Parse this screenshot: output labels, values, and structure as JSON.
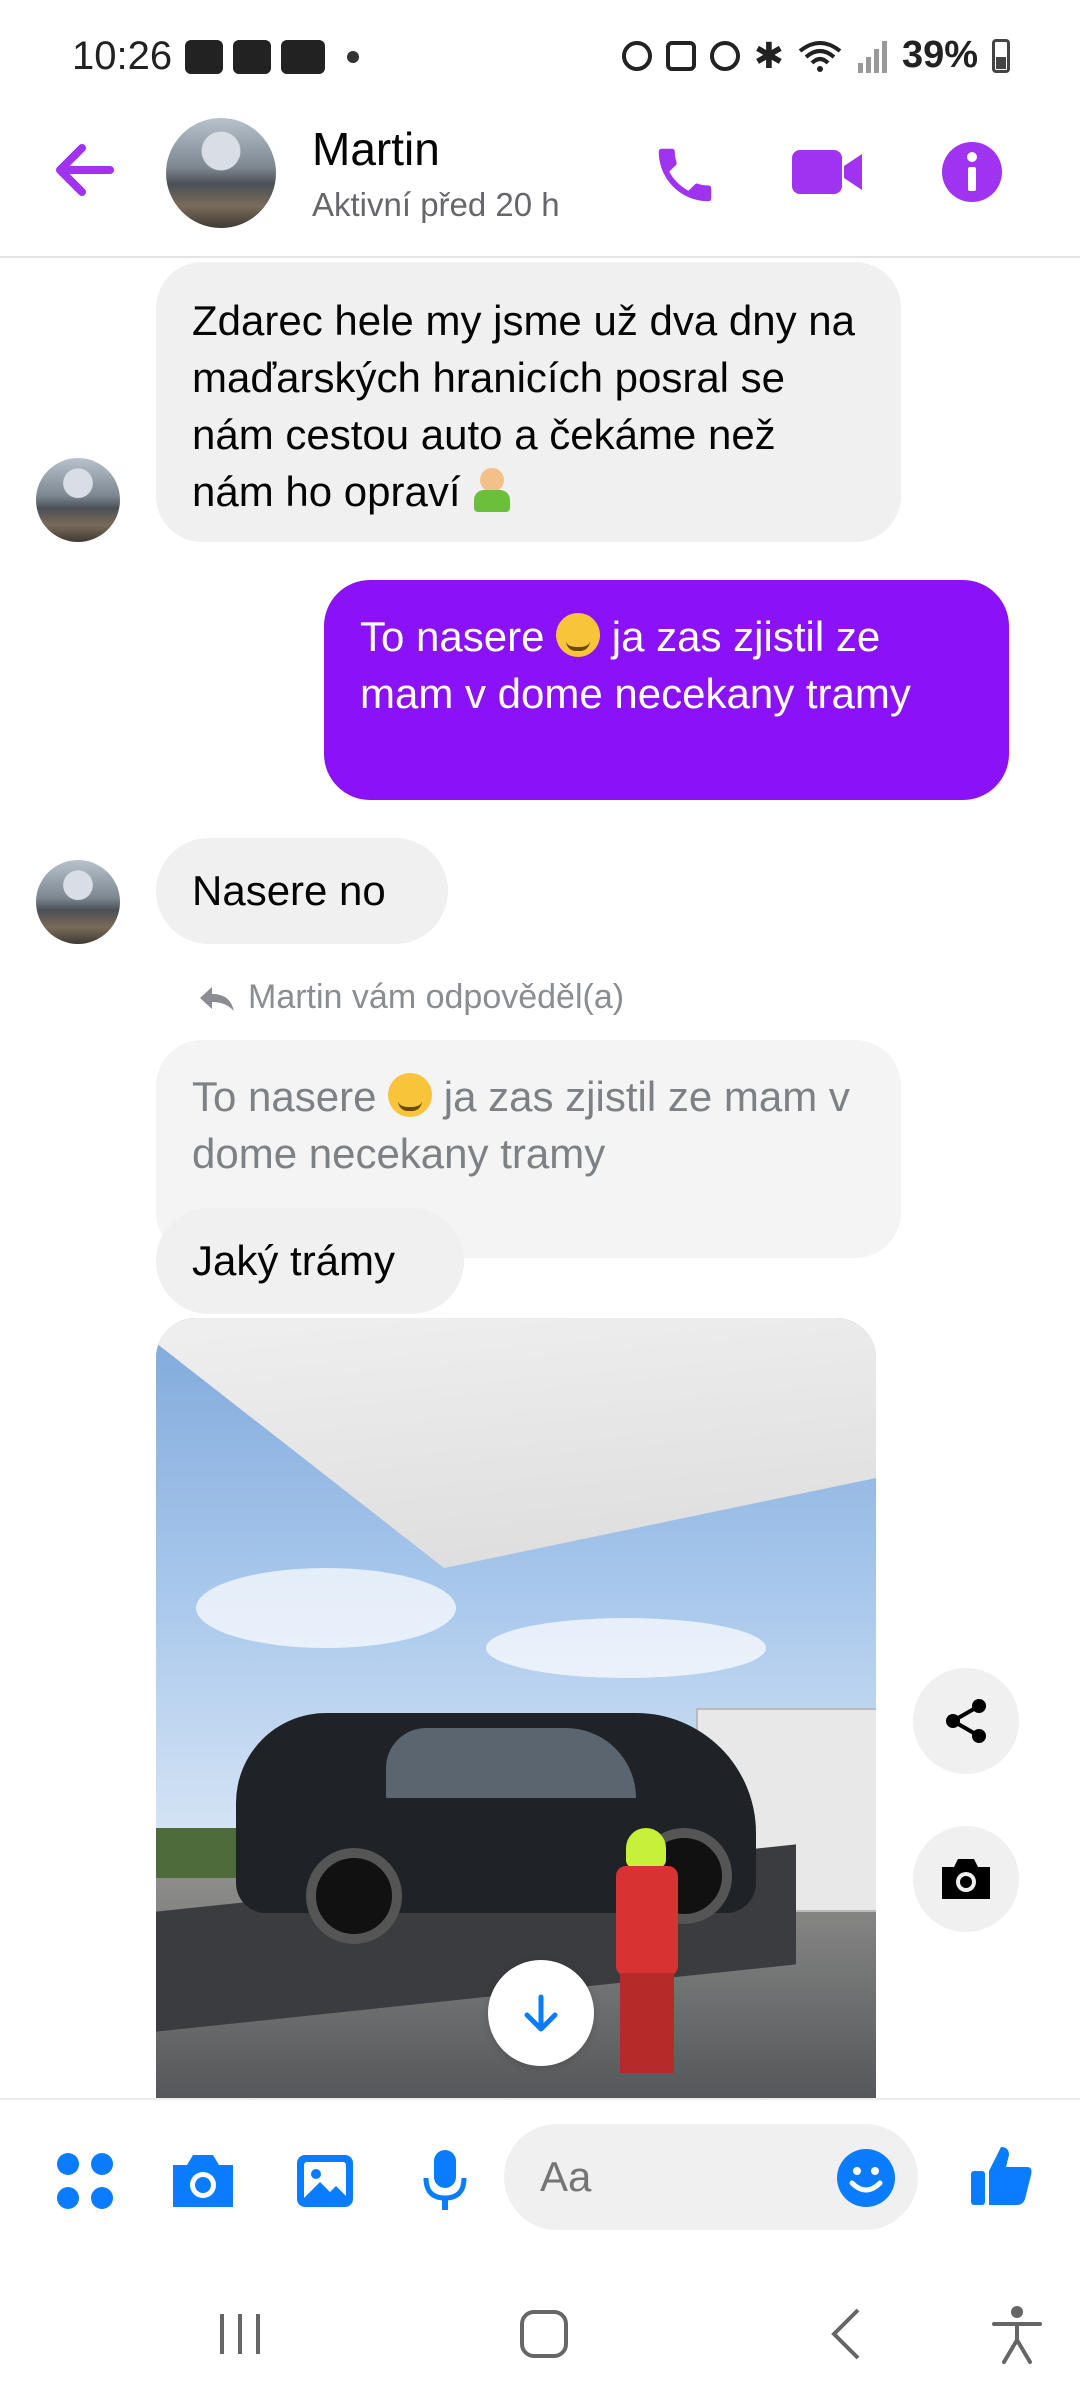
{
  "status_bar": {
    "time": "10:26",
    "battery": "39%"
  },
  "header": {
    "contact_name": "Martin",
    "contact_status": "Aktivní před 20 h",
    "accent_color": "#a033f0"
  },
  "messages": [
    {
      "sender": "Martin",
      "text": "Zdarec hele my jsme už dva dny na maďarských hranicích posral se nám cestou auto a čekáme než nám ho opraví"
    },
    {
      "sender": "me",
      "text_before": "To nasere",
      "text_after": "ja zas zjistil ze mam v dome necekany tramy"
    },
    {
      "sender": "Martin",
      "text": "Nasere no"
    }
  ],
  "reply": {
    "label": "Martin vám odpověděl(a)",
    "quoted_before": "To nasere",
    "quoted_after": "ja zas zjistil ze mam v dome necekany tramy",
    "text": "Jaký trámy"
  },
  "composer": {
    "placeholder": "Aa"
  },
  "colors": {
    "outgoing_bubble": "#8b12f6",
    "incoming_bubble": "#f0f0f0",
    "composer_icons": "#0a7cff"
  }
}
